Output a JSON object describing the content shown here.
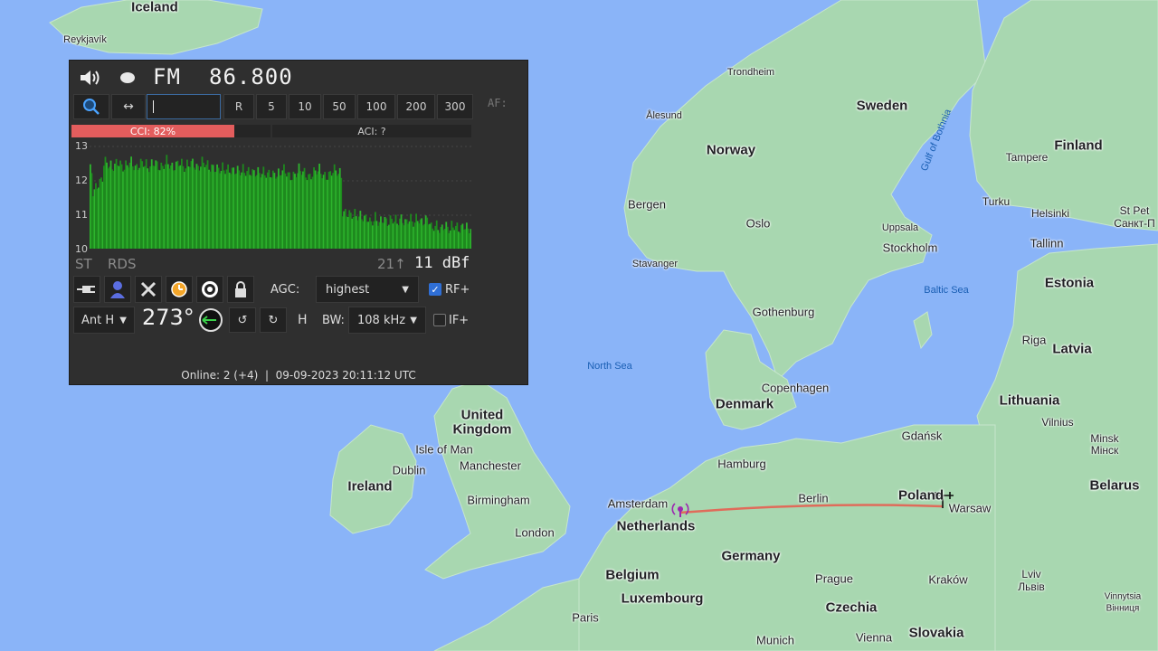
{
  "radio": {
    "mode": "FM",
    "frequency": "86.800",
    "af_label": "AF:",
    "buttons": [
      "R",
      "5",
      "10",
      "50",
      "100",
      "200",
      "300"
    ],
    "cci_label": "CCI: 82%",
    "cci_value": 0.82,
    "aci_label": "ACI: ?",
    "spectrum": {
      "y_ticks": [
        "13",
        "12",
        "11",
        "10"
      ],
      "ylim": [
        10,
        13
      ]
    },
    "st_label": "ST",
    "rds_label": "RDS",
    "signal_peak": "21↑",
    "signal_value": "11 dBf",
    "agc_label": "AGC:",
    "agc_value": "highest",
    "rf_plus_label": "RF+",
    "rf_plus_checked": true,
    "antenna": "Ant H",
    "azimuth": "273°",
    "polarization": "H",
    "bw_label": "BW:",
    "bw_value": "108 kHz",
    "if_plus_label": "IF+",
    "if_plus_checked": false,
    "status": "Online: 2 (+4)  |  09-09-2023 20:11:12 UTC",
    "colors": {
      "cci": "#e35d5d",
      "spectrum": "#1e8a1e",
      "panel": "#2f2f2f"
    }
  },
  "map": {
    "labels": {
      "iceland": "Iceland",
      "reykjavik": "Reykjavík",
      "sweden": "Sweden",
      "trondheim": "Trondheim",
      "alesund": "Ålesund",
      "norway": "Norway",
      "bergen": "Bergen",
      "oslo": "Oslo",
      "stavanger": "Stavanger",
      "uppsala": "Uppsala",
      "stockholm": "Stockholm",
      "gulf_of_bothnia": "Gulf of Bothnia",
      "finland": "Finland",
      "tampere": "Tampere",
      "turku": "Turku",
      "helsinki": "Helsinki",
      "st_petersburg": "St Pet",
      "st_petersburg_ru": "Санкт-П",
      "tallinn": "Tallinn",
      "estonia": "Estonia",
      "baltic_sea": "Baltic Sea",
      "riga": "Riga",
      "latvia": "Latvia",
      "gothenburg": "Gothenburg",
      "north_sea": "North Sea",
      "copenhagen": "Copenhagen",
      "denmark": "Denmark",
      "lithuania": "Lithuania",
      "vilnius": "Vilnius",
      "gdansk": "Gdańsk",
      "minsk": "Minsk",
      "minsk_ru": "Мінск",
      "belarus": "Belarus",
      "united_kingdom_1": "United",
      "united_kingdom_2": "Kingdom",
      "isle_of_man": "Isle of Man",
      "dublin": "Dublin",
      "ireland": "Ireland",
      "manchester": "Manchester",
      "birmingham": "Birmingham",
      "london": "London",
      "hamburg": "Hamburg",
      "amsterdam": "Amsterdam",
      "netherlands": "Netherlands",
      "berlin": "Berlin",
      "poland": "Poland",
      "warsaw": "Warsaw",
      "germany": "Germany",
      "belgium": "Belgium",
      "luxembourg": "Luxembourg",
      "prague": "Prague",
      "czechia": "Czechia",
      "krakow": "Kraków",
      "lviv": "Lviv",
      "lviv_uk": "Львів",
      "vinnytsia": "Vinnytsia",
      "vinnytsia_uk": "Вінниця",
      "paris": "Paris",
      "munich": "Munich",
      "vienna": "Vienna",
      "slovakia": "Slovakia"
    }
  }
}
